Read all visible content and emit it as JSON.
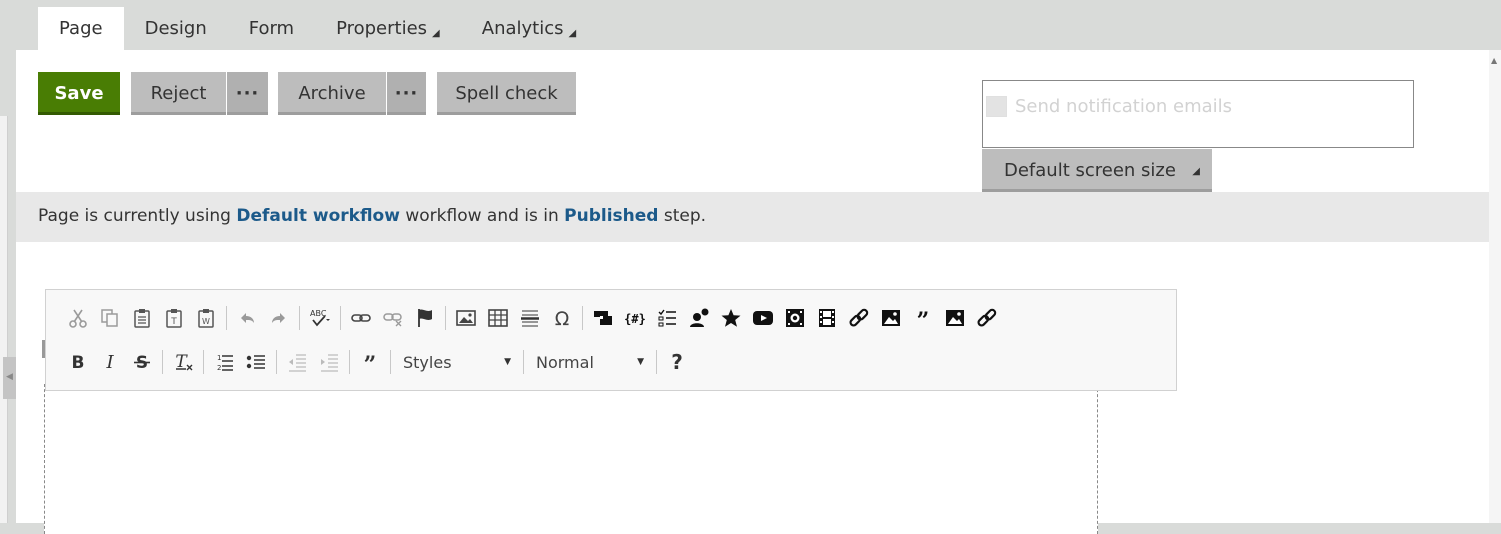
{
  "tabs": [
    {
      "label": "Page",
      "active": true,
      "has_caret": false
    },
    {
      "label": "Design",
      "active": false,
      "has_caret": false
    },
    {
      "label": "Form",
      "active": false,
      "has_caret": false
    },
    {
      "label": "Properties",
      "active": false,
      "has_caret": true
    },
    {
      "label": "Analytics",
      "active": false,
      "has_caret": true
    }
  ],
  "caret_glyph": "◢",
  "actions": {
    "save": "Save",
    "reject": "Reject",
    "reject_more": "···",
    "archive": "Archive",
    "archive_more": "···",
    "spell_check": "Spell check"
  },
  "notification": {
    "label": "Send notification emails",
    "checked": false,
    "disabled": true
  },
  "screen_size": {
    "label": "Default screen size"
  },
  "workflow_info": {
    "prefix": "Page is currently using ",
    "workflow_name": "Default workflow",
    "middle": " workflow and is in ",
    "step_name": "Published",
    "suffix": " step."
  },
  "toolbar": {
    "row1_icons": [
      "cut-icon",
      "copy-icon",
      "paste-icon",
      "paste-text-icon",
      "paste-word-icon",
      "|",
      "undo-icon",
      "redo-icon",
      "|",
      "spellcheck-icon",
      "|",
      "link-icon",
      "unlink-icon",
      "anchor-icon",
      "|",
      "image-icon",
      "table-icon",
      "horizontal-line-icon",
      "special-char-icon",
      "|",
      "widget-icon",
      "macro-icon",
      "checklist-icon",
      "user-add-icon",
      "star-icon",
      "youtube-icon",
      "media-icon",
      "film-icon",
      "quick-link-icon",
      "image-gallery-icon",
      "quote-icon",
      "insert-image-icon",
      "insert-link-icon"
    ],
    "row2_icons": [
      "bold-icon",
      "italic-icon",
      "strikethrough-icon",
      "|",
      "remove-format-icon",
      "|",
      "numbered-list-icon",
      "bullet-list-icon",
      "|",
      "outdent-icon",
      "indent-icon",
      "|",
      "blockquote-icon",
      "|"
    ],
    "styles_label": "Styles",
    "format_label": "Normal",
    "help_label": "?"
  },
  "colors": {
    "save_green": "#497d04",
    "link_blue": "#1c5a8a",
    "button_gray": "#bdbdbd",
    "chrome_gray": "#d9dbd9"
  }
}
